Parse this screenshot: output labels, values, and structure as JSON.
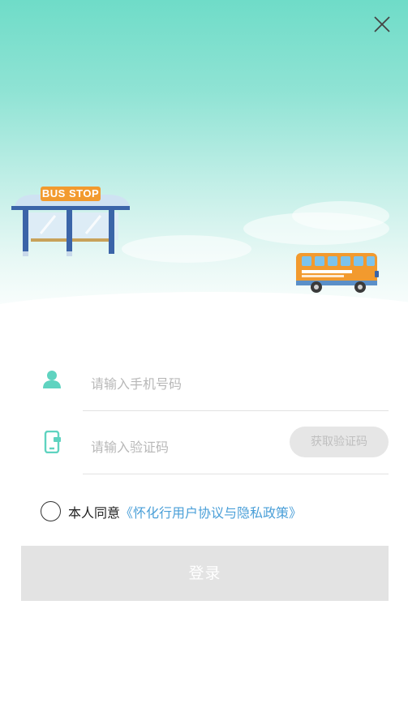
{
  "header": {
    "bus_stop_sign": "BUS STOP"
  },
  "form": {
    "phone": {
      "placeholder": "请输入手机号码",
      "value": ""
    },
    "code": {
      "placeholder": "请输入验证码",
      "value": ""
    },
    "get_code_label": "获取验证码"
  },
  "agreement": {
    "checked": false,
    "prefix": "本人同意",
    "link": "《怀化行用户协议与隐私政策》"
  },
  "login_label": "登录",
  "colors": {
    "accent": "#6fdcc8",
    "icon": "#5fd3c0",
    "link": "#4a9fd8",
    "button_disabled": "#e3e3e3",
    "bus": "#f29a2e"
  },
  "icons": [
    "close-icon",
    "user-icon",
    "mobile-phone-icon",
    "radio-unchecked-icon"
  ]
}
